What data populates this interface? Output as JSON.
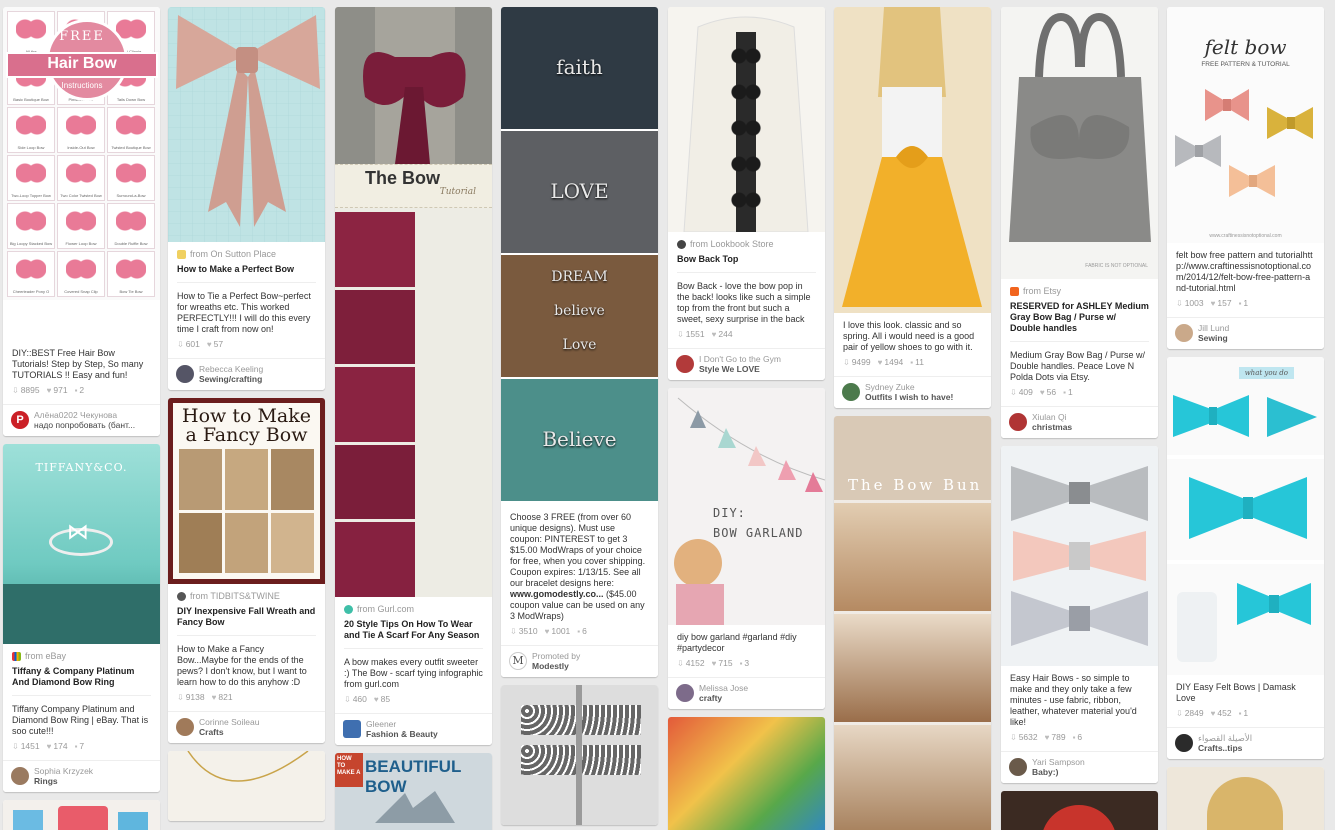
{
  "colors": {
    "page_bg": "#e9e9e9",
    "card_bg": "#ffffff",
    "pinterest_red": "#cb2027",
    "tiffany_blue": "#81d8d0",
    "yellow_skirt": "#f2b02a"
  },
  "icons": {
    "repin": "pin-icon",
    "like": "heart-icon",
    "comment": "comment-icon"
  },
  "pins": {
    "free_hair_bow": {
      "overlay_free": "FREE",
      "overlay_title": "Hair Bow",
      "overlay_sub": "Instructions",
      "grid_labels": [
        "All the",
        "Funky Loops Bow",
        "Mini Clippie",
        "Basic Boutique Bow",
        "Pinwheel Bow",
        "Tails Down Bow",
        "Side Loop Bow",
        "Inside-Out Bow",
        "Twisted Boutique Bow",
        "Two-Loop Topper Bow",
        "Two Color Twisted Bow",
        "Surround-a-Bow",
        "Big Loopy Stacked Bow",
        "Flower Loop Bow",
        "Double Ruffle Bow",
        "Cheerleader Pony O",
        "Covered Snap Clip",
        "Bow Tie Bow"
      ],
      "desc": "DIY::BEST Free Hair Bow Tutorials! Step by Step, So many TUTORIALS !! Easy and fun!",
      "repins": "8895",
      "likes": "971",
      "comments": "2",
      "pinner_name": "Алёна0202 Чекунова",
      "pinner_board": "надо попробовать (бант..."
    },
    "tiffany": {
      "overlay_brand": "TIFFANY&CO.",
      "source": "from eBay",
      "title": "Tiffany & Company Platinum And Diamond Bow Ring",
      "desc": "Tiffany Company Platinum and Diamond Bow Ring | eBay. That is soo cute!!!",
      "repins": "1451",
      "likes": "174",
      "comments": "7",
      "pinner_name": "Sophia Krzyzek",
      "pinner_board": "Rings"
    },
    "perfect_bow": {
      "source": "from On Sutton Place",
      "title": "How to Make a Perfect Bow",
      "desc": "How to Tie a Perfect Bow~perfect for wreaths etc. This worked PERFECTLY!!! I will do this every time I craft from now on!",
      "repins": "601",
      "likes": "57",
      "pinner_name": "Rebecca Keeling",
      "pinner_board": "Sewing/crafting"
    },
    "fancy_bow": {
      "overlay_title": "How to Make a Fancy Bow",
      "source": "from TIDBITS&TWINE",
      "title": "DIY Inexpensive Fall Wreath and Fancy Bow",
      "desc": "How to Make a Fancy Bow...Maybe for the ends of the pews? I don't know, but I want to learn how to do this anyhow :D",
      "repins": "9138",
      "likes": "821",
      "pinner_name": "Corinne Soileau",
      "pinner_board": "Crafts"
    },
    "scarf_bow": {
      "overlay_title": "The Bow",
      "overlay_sub": "Tutorial",
      "source": "from Gurl.com",
      "title": "20 Style Tips On How To Wear and Tie A Scarf For Any Season",
      "desc": "A bow makes every outfit sweeter :) The Bow - scarf tying infographic from gurl.com",
      "repins": "460",
      "likes": "85",
      "pinner_name": "Gleener",
      "pinner_board": "Fashion & Beauty"
    },
    "beautiful_bow": {
      "overlay_small": "HOW TO MAKE A",
      "overlay_title": "BEAUTIFUL BOW"
    },
    "bracelets": {
      "overlay_words": [
        "faith",
        "LOVE",
        "DREAM",
        "believe",
        "Love",
        "Believe"
      ],
      "desc": "Choose 3 FREE (from over 60 unique designs). Must use coupon: PINTEREST to get 3 $15.00 ModWraps of your choice for free, when you cover shipping. Coupon expires: 1/13/15. See all our bracelet designs here:",
      "desc_link": "www.gomodestly.co...",
      "desc_tail": "($45.00 coupon value can be used on any 3 ModWraps)",
      "repins": "3510",
      "likes": "1001",
      "comments": "6",
      "promoted_label": "Promoted by",
      "promoted_name": "Modestly"
    },
    "bow_back": {
      "source": "from Lookbook Store",
      "title": "Bow Back Top",
      "desc": "Bow Back - love the bow pop in the back! looks like such a simple top from the front but such a sweet, sexy surprise in the back",
      "repins": "1551",
      "likes": "244",
      "pinner_name": "I Don't Go to the Gym",
      "pinner_board": "Style We LOVE"
    },
    "bow_garland": {
      "overlay_title": "DIY:",
      "overlay_sub": "BOW GARLAND",
      "desc": "diy bow garland #garland #diy #partydecor",
      "repins": "4152",
      "likes": "715",
      "comments": "3",
      "pinner_name": "Melissa Jose",
      "pinner_board": "crafty"
    },
    "yellow_skirt": {
      "desc": "I love this look. classic and so spring. All i would need is a good pair of yellow shoes to go with it.",
      "repins": "9499",
      "likes": "1494",
      "comments": "11",
      "pinner_name": "Sydney Zuke",
      "pinner_board": "Outfits I wish to have!"
    },
    "bow_bun": {
      "overlay_title": "The Bow Bun"
    },
    "gray_bag": {
      "overlay_label": "FABRIC IS NOT OPTIONAL",
      "source": "from Etsy",
      "title": "RESERVED for ASHLEY Medium Gray Bow Bag / Purse w/ Double handles",
      "desc": "Medium Gray Bow Bag / Purse w/ Double handles. Peace Love N Polda Dots via Etsy.",
      "repins": "409",
      "likes": "56",
      "comments": "1",
      "pinner_name": "Xiulan Qi",
      "pinner_board": "christmas"
    },
    "hair_bows": {
      "desc": "Easy Hair Bows - so simple to make and they only take a few minutes - use fabric, ribbon, leather, whatever material you'd like!",
      "repins": "5632",
      "likes": "789",
      "comments": "6",
      "pinner_name": "Yari Sampson",
      "pinner_board": "Baby:)"
    },
    "felt_bow": {
      "overlay_title": "felt bow",
      "overlay_sub": "FREE PATTERN & TUTORIAL",
      "overlay_url": "www.craftinessisnotoptional.com",
      "desc": "felt bow free pattern and tutorialhttp://www.craftinessisnotoptional.com/2014/12/felt-bow-free-pattern-and-tutorial.html",
      "repins": "1003",
      "likes": "157",
      "comments": "1",
      "pinner_name": "Jill Lund",
      "pinner_board": "Sewing"
    },
    "easy_felt_bow": {
      "overlay_label": "what you do",
      "desc": "DIY Easy Felt Bows | Damask Love",
      "repins": "2849",
      "likes": "452",
      "comments": "1",
      "pinner_name": "الأصيلة القصواء",
      "pinner_board": "Crafts..tips"
    }
  }
}
